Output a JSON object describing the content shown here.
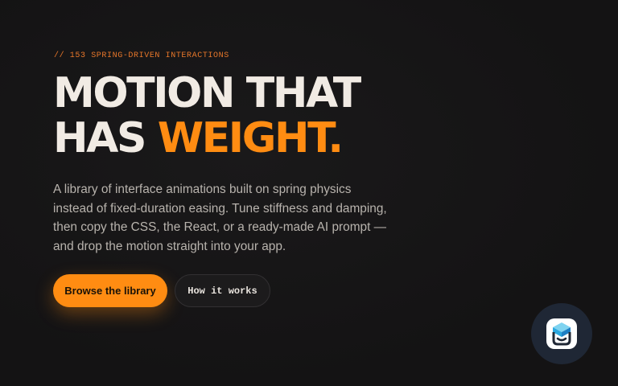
{
  "hero": {
    "eyebrow": "// 153 SPRING-DRIVEN INTERACTIONS",
    "headline_line1": "MOTION THAT",
    "headline_line2_plain": "HAS ",
    "headline_line2_accent": "WEIGHT.",
    "lead": "A library of interface animations built on spring physics instead of fixed-duration easing. Tune stiffness and damping, then copy the CSS, the React, or a ready-made AI prompt — and drop the motion straight into your app."
  },
  "actions": {
    "primary_label": "Browse the library",
    "secondary_label": "How it works"
  },
  "widget": {
    "icon": "smiling-box-icon"
  },
  "colors": {
    "background": "#151415",
    "accent": "#ff8c12",
    "heading": "#f1ebe4",
    "body_text": "#b8b3ad"
  }
}
